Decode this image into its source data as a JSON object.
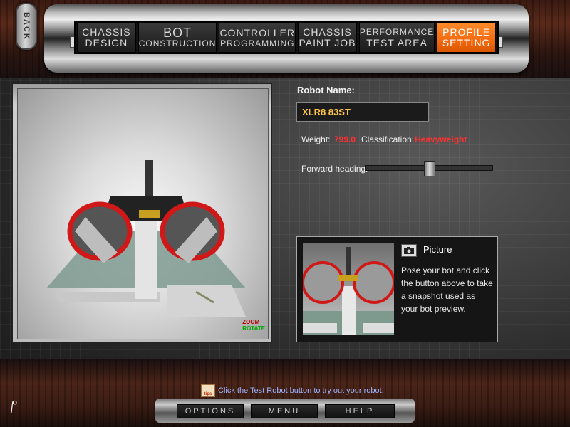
{
  "back_label": "BACK",
  "nav": [
    {
      "line1": "CHASSIS",
      "line2": "DESIGN",
      "active": false
    },
    {
      "line1": "BOT",
      "line2": "CONSTRUCTION",
      "active": false
    },
    {
      "line1": "CONTROLLER",
      "line2": "PROGRAMMING",
      "active": false
    },
    {
      "line1": "CHASSIS",
      "line2": "PAINT JOB",
      "active": false
    },
    {
      "line1": "PERFORMANCE",
      "line2": "TEST AREA",
      "active": false
    },
    {
      "line1": "PROFILE",
      "line2": "SETTING",
      "active": true
    }
  ],
  "viewport": {
    "zoom_hint": "ZOOM",
    "rotate_hint": "ROTATE"
  },
  "profile": {
    "name_label": "Robot Name:",
    "name_value": "XLR8 83ST",
    "weight_label": "Weight:",
    "weight_value": "799.0",
    "classification_label": "Classification:",
    "classification_value": "Heavyweight",
    "heading_label": "Forward heading:",
    "heading_level": 0.5
  },
  "picture": {
    "title": "Picture",
    "description": "Pose your bot and click the button above to take a snapshot used as your bot preview."
  },
  "tip": {
    "icon_text": "tips",
    "text": "Click the Test Robot button to try out your robot."
  },
  "footer": {
    "options": "OPTIONS",
    "menu": "MENU",
    "help": "HELP"
  },
  "colors": {
    "accent": "#f46a10",
    "name_text": "#ffc64a",
    "warning": "#ff3030",
    "tip_text": "#9fb4ff"
  }
}
